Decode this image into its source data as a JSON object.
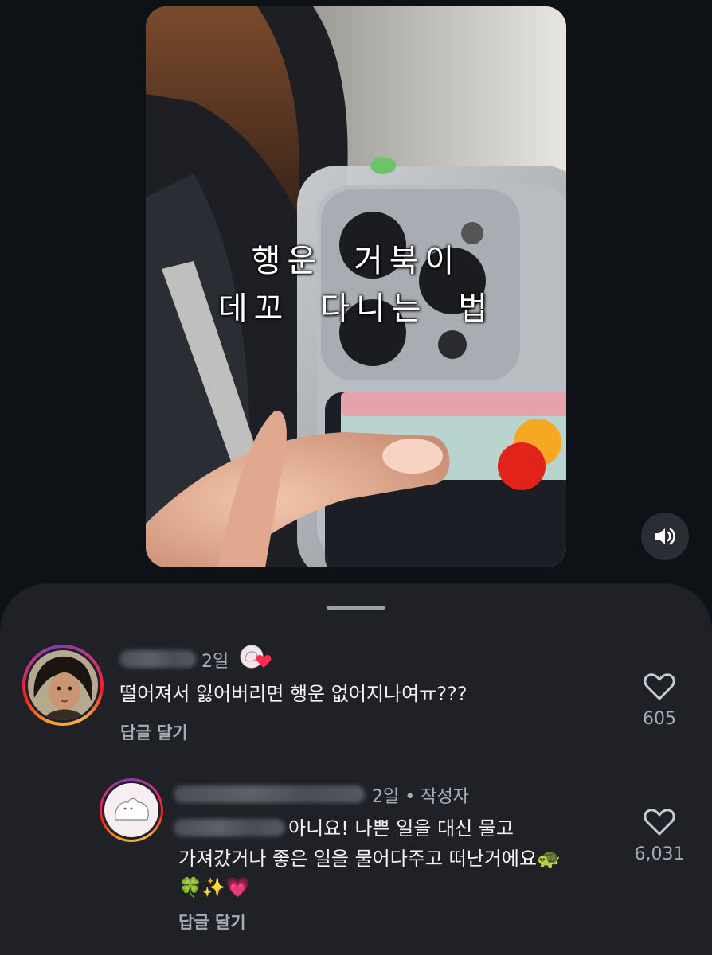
{
  "video": {
    "caption_line1": "행운 거북이",
    "caption_line2": "데꼬 다니는 법",
    "sound_icon": "speaker-icon"
  },
  "comments": [
    {
      "time": "2일",
      "text": "떨어져서 잃어버리면 행운 없어지나여ㅠ???",
      "reply_label": "답글 달기",
      "likes": "605"
    },
    {
      "meta": "2일 • 작성자",
      "text_line1": "아니요! 나쁜 일을 대신 물고",
      "text_line2": "가져갔거나 좋은 일을 물어다주고 떠난거에요🐢",
      "text_line3": "🍀✨💗",
      "reply_label": "답글 달기",
      "likes": "6,031"
    }
  ],
  "colors": {
    "background": "#0e1217",
    "sheet": "#1f2127",
    "muted_text": "#a8adb5",
    "heart_badge": "#ff2d55"
  }
}
